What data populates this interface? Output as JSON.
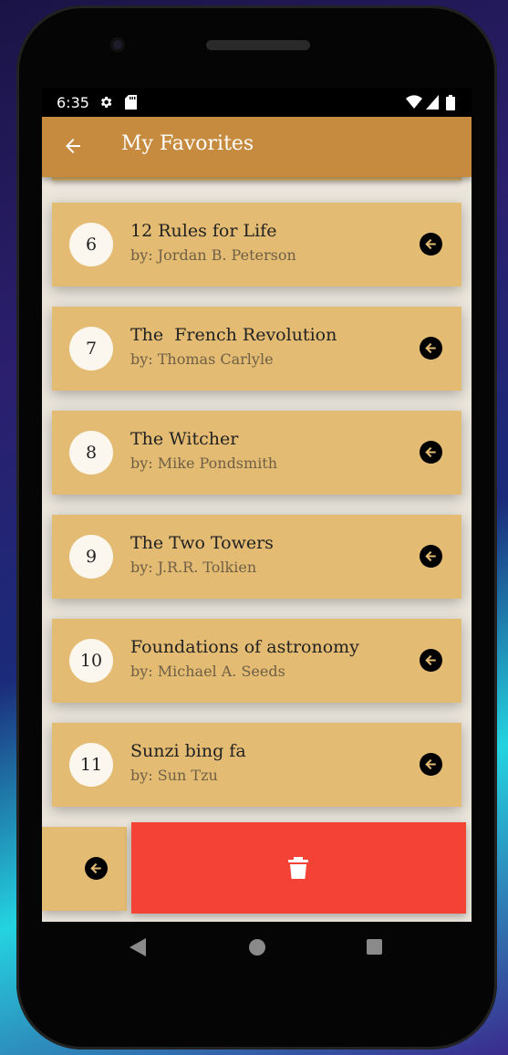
{
  "status_bar": {
    "time": "6:35",
    "icons": [
      "settings-icon",
      "sd-card-icon",
      "wifi-icon",
      "signal-icon",
      "battery-icon"
    ]
  },
  "app_bar": {
    "title": "My Favorites",
    "back_icon": "arrow-back-icon",
    "color": "#c68b3f"
  },
  "favorites": [
    {
      "number": "6",
      "title": "12 Rules for Life",
      "author": "by: Jordan B. Peterson"
    },
    {
      "number": "7",
      "title": "The  French Revolution",
      "author": "by: Thomas Carlyle"
    },
    {
      "number": "8",
      "title": "The Witcher",
      "author": "by: Mike Pondsmith"
    },
    {
      "number": "9",
      "title": "The Two Towers",
      "author": "by: J.R.R. Tolkien"
    },
    {
      "number": "10",
      "title": "Foundations of astronomy",
      "author": "by: Michael A. Seeds"
    },
    {
      "number": "11",
      "title": "Sunzi bing fa",
      "author": "by: Sun Tzu"
    }
  ],
  "swipe_action": {
    "icon": "delete-icon",
    "color": "#f44336"
  },
  "colors": {
    "card": "#e3bb72",
    "background": "#ebe6dc"
  },
  "nav_bar": {
    "icons": [
      "nav-back-icon",
      "nav-home-icon",
      "nav-recents-icon"
    ]
  }
}
